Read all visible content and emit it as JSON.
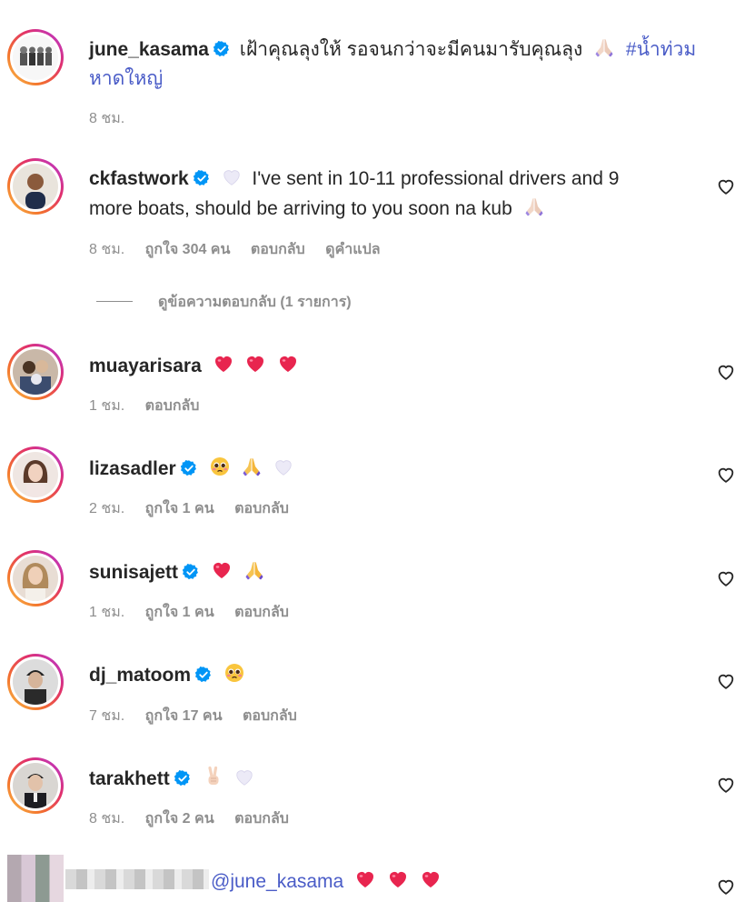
{
  "caption": {
    "username": "june_kasama",
    "text": "เฝ้าคุณลุงให้ รอจนกว่าจะมีคนมารับคุณลุง",
    "hashtag": "#น้ำท่วมหาดใหญ่",
    "hashtag_line1": "#น้ำท่วม",
    "hashtag_line2": "หาดใหญ่",
    "time": "8 ชม."
  },
  "comments": [
    {
      "username": "ckfastwork",
      "verified": true,
      "text_line1": "I've sent in 10-11 professional drivers and 9",
      "text_line2": "more boats, should be arriving to you soon na kub",
      "time": "8 ชม.",
      "likes": "ถูกใจ 304 คน",
      "reply": "ตอบกลับ",
      "translate": "ดูคำแปล",
      "view_replies": "ดูข้อความตอบกลับ (1 รายการ)"
    },
    {
      "username": "muayarisara",
      "verified": false,
      "time": "1 ชม.",
      "reply": "ตอบกลับ"
    },
    {
      "username": "lizasadler",
      "verified": true,
      "time": "2 ชม.",
      "likes": "ถูกใจ 1 คน",
      "reply": "ตอบกลับ"
    },
    {
      "username": "sunisajett",
      "verified": true,
      "time": "1 ชม.",
      "likes": "ถูกใจ 1 คน",
      "reply": "ตอบกลับ"
    },
    {
      "username": "dj_matoom",
      "verified": true,
      "time": "7 ชม.",
      "likes": "ถูกใจ 17 คน",
      "reply": "ตอบกลับ"
    },
    {
      "username": "tarakhett",
      "verified": true,
      "time": "8 ชม.",
      "likes": "ถูกใจ 2 คน",
      "reply": "ตอบกลับ"
    },
    {
      "mention": "@june_kasama"
    }
  ],
  "colors": {
    "text": "#262626",
    "meta": "#8e8e8e",
    "hashtag": "#4a5cc7",
    "verified": "#0095f6",
    "heart_emoji": "#e8254f"
  },
  "icons": [
    "verified-badge-icon",
    "like-heart-icon",
    "red-heart-emoji",
    "white-heart-emoji",
    "praying-hands-emoji",
    "pleading-face-emoji",
    "victory-hand-emoji"
  ]
}
